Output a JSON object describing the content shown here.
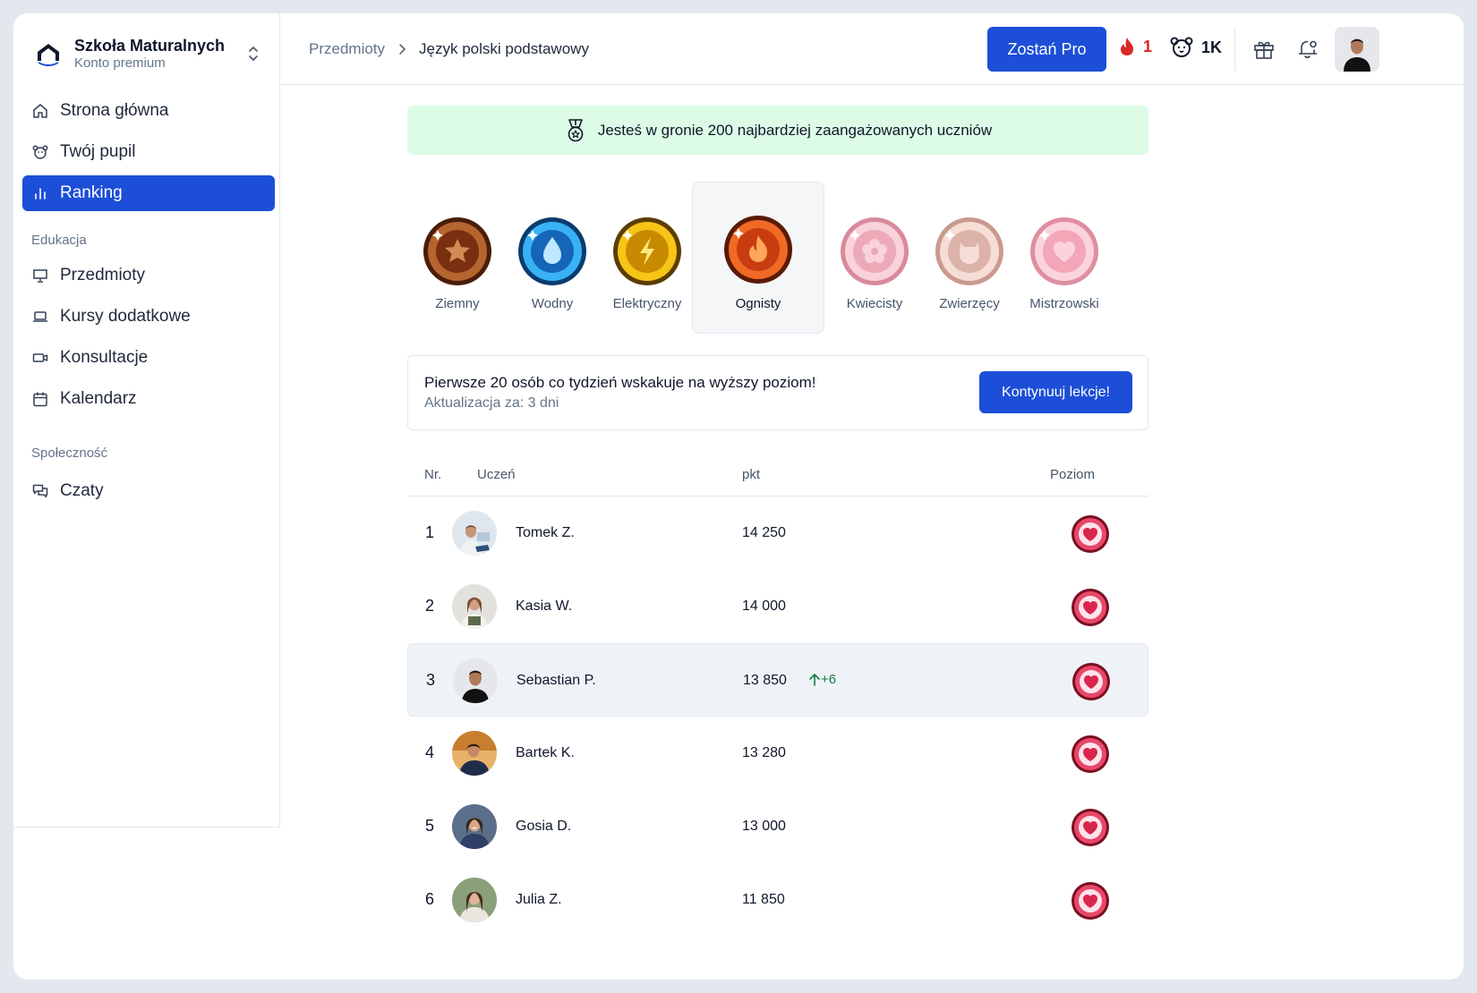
{
  "brand": {
    "name": "Szkoła Maturalnych",
    "subtitle": "Konto premium"
  },
  "sidebar": {
    "main_items": [
      {
        "label": "Strona główna",
        "icon": "home-icon"
      },
      {
        "label": "Twój pupil",
        "icon": "pet-icon"
      },
      {
        "label": "Ranking",
        "icon": "bar-chart-icon",
        "active": true
      }
    ],
    "education": {
      "title": "Edukacja",
      "items": [
        {
          "label": "Przedmioty",
          "icon": "presentation-icon"
        },
        {
          "label": "Kursy dodatkowe",
          "icon": "laptop-icon"
        },
        {
          "label": "Konsultacje",
          "icon": "video-icon"
        },
        {
          "label": "Kalendarz",
          "icon": "calendar-icon"
        }
      ]
    },
    "community": {
      "title": "Społeczność",
      "items": [
        {
          "label": "Czaty",
          "icon": "chat-icon"
        }
      ]
    }
  },
  "header": {
    "breadcrumb": {
      "parent": "Przedmioty",
      "current": "Język polski podstawowy"
    },
    "pro_button": "Zostań Pro",
    "streak": "1",
    "pet_points": "1K"
  },
  "banner": {
    "text": "Jesteś w gronie 200 najbardziej zaangażowanych uczniów"
  },
  "leagues": [
    {
      "name": "Ziemny",
      "color": "#8b3a12"
    },
    {
      "name": "Wodny",
      "color": "#1e88d8"
    },
    {
      "name": "Elektryczny",
      "color": "#e0a800"
    },
    {
      "name": "Ognisty",
      "color": "#e8541e",
      "active": true
    },
    {
      "name": "Kwiecisty",
      "color": "#f0a5b5"
    },
    {
      "name": "Zwierzęcy",
      "color": "#e8b8ac"
    },
    {
      "name": "Mistrzowski",
      "color": "#f4a8b8"
    }
  ],
  "promo": {
    "title": "Pierwsze 20 osób co tydzień wskakuje na wyższy poziom!",
    "subtitle": "Aktualizacja za: 3 dni",
    "button": "Kontynuuj lekcje!"
  },
  "table": {
    "headers": {
      "nr": "Nr.",
      "student": "Uczeń",
      "points": "pkt",
      "level": "Poziom"
    },
    "rows": [
      {
        "nr": "1",
        "name": "Tomek Z.",
        "points": "14 250",
        "delta": ""
      },
      {
        "nr": "2",
        "name": "Kasia W.",
        "points": "14 000",
        "delta": ""
      },
      {
        "nr": "3",
        "name": "Sebastian P.",
        "points": "13 850",
        "delta": "+6",
        "current": true
      },
      {
        "nr": "4",
        "name": "Bartek K.",
        "points": "13 280",
        "delta": ""
      },
      {
        "nr": "5",
        "name": "Gosia D.",
        "points": "13 000",
        "delta": ""
      },
      {
        "nr": "6",
        "name": "Julia Z.",
        "points": "11 850",
        "delta": ""
      }
    ]
  },
  "colors": {
    "accent": "#1d4ed8",
    "banner_bg": "#dcfce7",
    "streak": "#dc2626",
    "delta_up": "#15803d"
  }
}
